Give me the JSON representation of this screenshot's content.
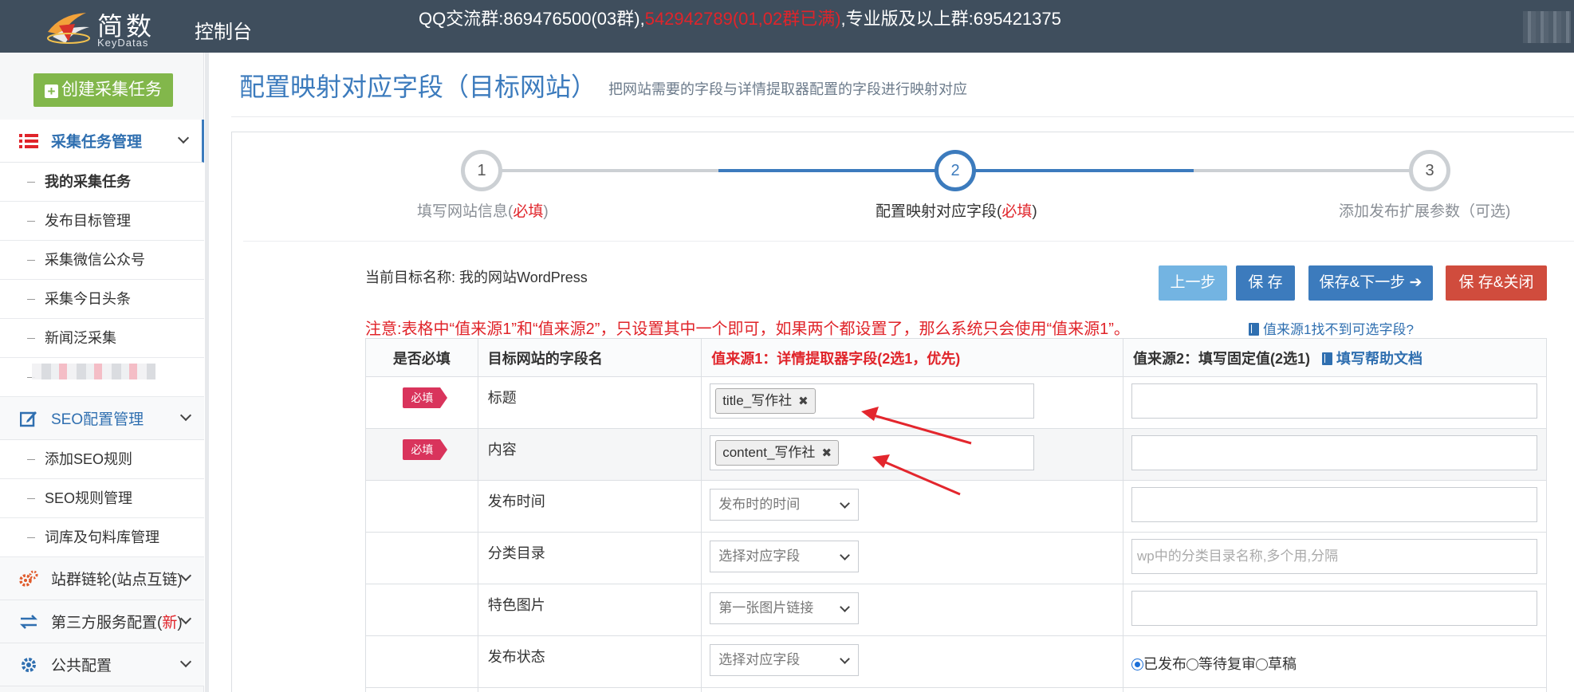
{
  "header": {
    "logo_cn": "简数",
    "logo_en": "KeyDatas",
    "console": "控制台",
    "qq_part1": "QQ交流群:869476500(03群),",
    "qq_part2": "542942789(01,02群已满)",
    "qq_part3": ",专业版及以上群:695421375"
  },
  "sidebar": {
    "create_button": "创建采集任务",
    "groups": [
      {
        "label": "采集任务管理",
        "icon": "list-icon"
      },
      {
        "label": "SEO配置管理",
        "icon": "edit-icon"
      },
      {
        "label": "站群链轮(站点互链)",
        "icon": "gears-icon"
      },
      {
        "label": "第三方服务配置(新)",
        "icon": "exchange-icon"
      },
      {
        "label": "公共配置",
        "icon": "gear-icon"
      }
    ],
    "third_party_main": "第三方服务配置(",
    "third_party_new": "新",
    "third_party_end": ")",
    "task_items": [
      "我的采集任务",
      "发布目标管理",
      "采集微信公众号",
      "采集今日头条",
      "新闻泛采集"
    ],
    "seo_items": [
      "添加SEO规则",
      "SEO规则管理",
      "词库及句料库管理"
    ]
  },
  "page": {
    "title": "配置映射对应字段（目标网站）",
    "subtitle": "把网站需要的字段与详情提取器配置的字段进行映射对应"
  },
  "steps": [
    {
      "num": "1",
      "label": "填写网站信息(",
      "req": "必填",
      "end": ")"
    },
    {
      "num": "2",
      "label": "配置映射对应字段(",
      "req": "必填",
      "end": ")"
    },
    {
      "num": "3",
      "label": "添加发布扩展参数（可选)",
      "req": "",
      "end": ""
    }
  ],
  "target": {
    "label": "当前目标名称:",
    "name": "我的网站WordPress"
  },
  "buttons": {
    "prev": "上一步",
    "save": "保 存",
    "save_next": "保存&下一步",
    "save_close": "保 存&关闭"
  },
  "notice": "注意:表格中“值来源1”和“值来源2”，只设置其中一个即可，如果两个都设置了，那么系统只会使用“值来源1”。",
  "help_link": "值来源1找不到可选字段?",
  "table": {
    "headers": {
      "required": "是否必填",
      "field": "目标网站的字段名",
      "source1": "值来源1：详情提取器字段(2选1，优先)",
      "source2": "值来源2：填写固定值(2选1)",
      "doc_link": "填写帮助文档"
    },
    "required_tag": "必填",
    "rows": [
      {
        "field": "标题",
        "chip": "title_写作社",
        "select": ""
      },
      {
        "field": "内容",
        "chip": "content_写作社",
        "select": ""
      },
      {
        "field": "发布时间",
        "chip": "",
        "select": "发布时的时间"
      },
      {
        "field": "分类目录",
        "chip": "",
        "select": "选择对应字段",
        "placeholder": "wp中的分类目录名称,多个用,分隔"
      },
      {
        "field": "特色图片",
        "chip": "",
        "select": "第一张图片链接"
      },
      {
        "field": "发布状态",
        "chip": "",
        "select": "选择对应字段"
      }
    ],
    "status_options": [
      "已发布",
      "等待复审",
      "草稿"
    ]
  },
  "colors": {
    "accent": "#3c7bbd",
    "topbar": "#3f4e5d",
    "danger": "#d04c3d",
    "required_tag": "#d9345c",
    "create": "#82b74b"
  }
}
